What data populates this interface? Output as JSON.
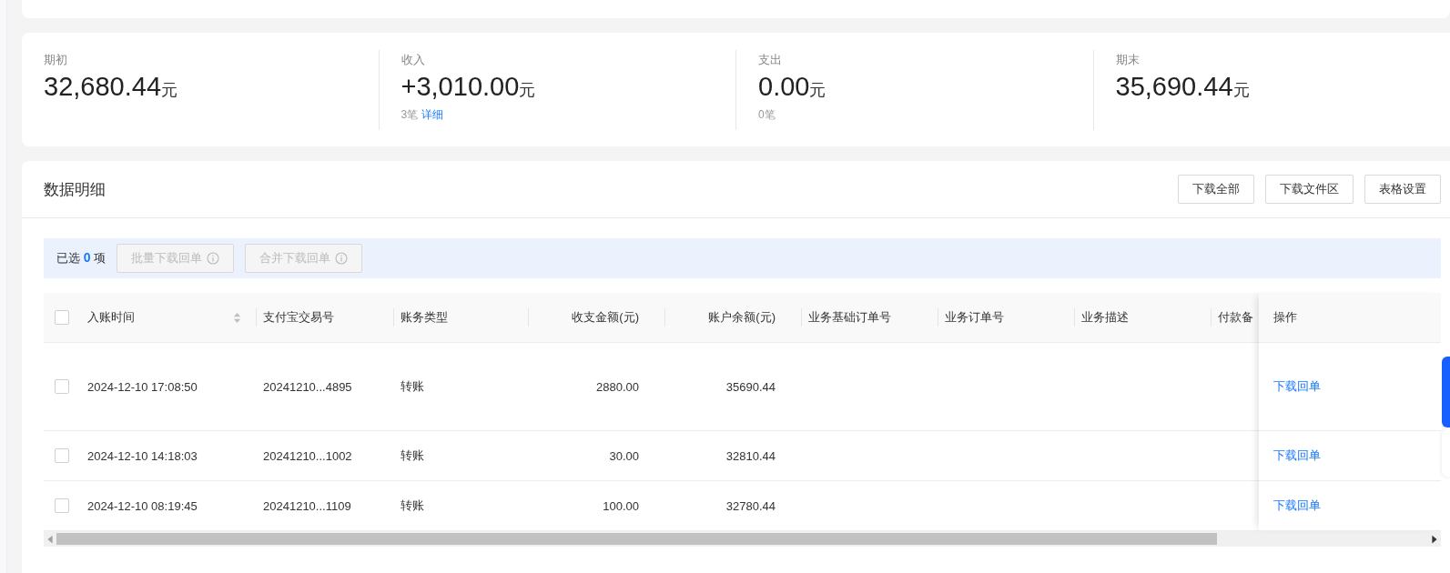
{
  "summary": [
    {
      "label": "期初",
      "value": "32,680.44",
      "unit": "元"
    },
    {
      "label": "收入",
      "value": "+3,010.00",
      "unit": "元",
      "count": "3笔",
      "link": "详细"
    },
    {
      "label": "支出",
      "value": "0.00",
      "unit": "元",
      "count": "0笔"
    },
    {
      "label": "期末",
      "value": "35,690.44",
      "unit": "元"
    }
  ],
  "detail": {
    "title": "数据明细",
    "buttons": [
      "下载全部",
      "下载文件区",
      "表格设置"
    ],
    "selection": {
      "prefix": "已选",
      "count": "0",
      "suffix": "项"
    },
    "batch_buttons": [
      {
        "label": "批量下载回单",
        "disabled": true
      },
      {
        "label": "合并下载回单",
        "disabled": true
      }
    ],
    "table": {
      "all_checked": false,
      "columns": [
        {
          "label": "入账时间",
          "sortable": true
        },
        {
          "label": "支付宝交易号",
          "sortable": false
        },
        {
          "label": "账务类型",
          "sortable": false
        },
        {
          "label": "收支金额(元)",
          "sortable": false
        },
        {
          "label": "账户余额(元)",
          "sortable": false
        },
        {
          "label": "业务基础订单号",
          "sortable": false
        },
        {
          "label": "业务订单号",
          "sortable": false
        },
        {
          "label": "业务描述",
          "sortable": false
        },
        {
          "label": "付款备",
          "sortable": false
        }
      ],
      "action_column": "操作",
      "rows": [
        {
          "checked": false,
          "cells": [
            "2024-12-10 17:08:50",
            "20241210...4895",
            "转账",
            "2880.00",
            "35690.44"
          ],
          "action": "下载回单"
        },
        {
          "checked": false,
          "cells": [
            "2024-12-10 14:18:03",
            "20241210...1002",
            "转账",
            "30.00",
            "32810.44"
          ],
          "action": "下载回单"
        },
        {
          "checked": false,
          "cells": [
            "2024-12-10 08:19:45",
            "20241210...1109",
            "转账",
            "100.00",
            "32780.44"
          ],
          "action": "下载回单"
        }
      ]
    }
  }
}
